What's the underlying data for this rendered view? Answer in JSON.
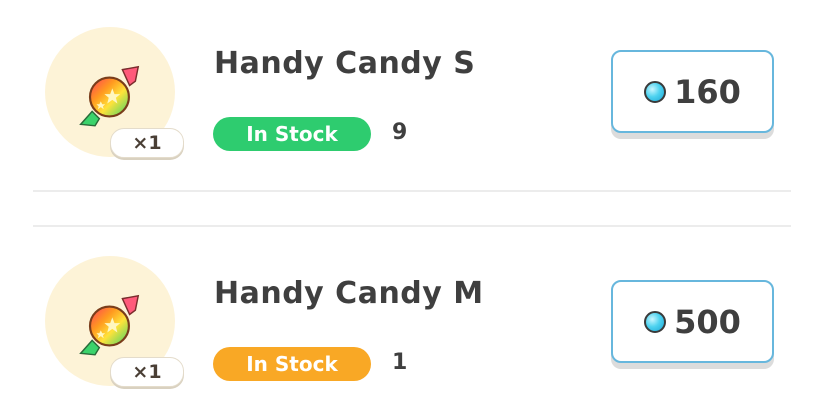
{
  "items": [
    {
      "name": "Handy Candy S",
      "quantity": "×1",
      "stock_label": "In Stock",
      "stock_count": "9",
      "stock_color": "#2ecc6f",
      "price": "160",
      "icon": "candy-icon",
      "currency_icon": "gem-icon"
    },
    {
      "name": "Handy Candy M",
      "quantity": "×1",
      "stock_label": "In Stock",
      "stock_count": "1",
      "stock_color": "#f9a825",
      "price": "500",
      "icon": "candy-icon",
      "currency_icon": "gem-icon"
    }
  ],
  "colors": {
    "price_border": "#67b7dd",
    "thumb_background": "#fdf3d7",
    "text": "#3f3f3f"
  }
}
